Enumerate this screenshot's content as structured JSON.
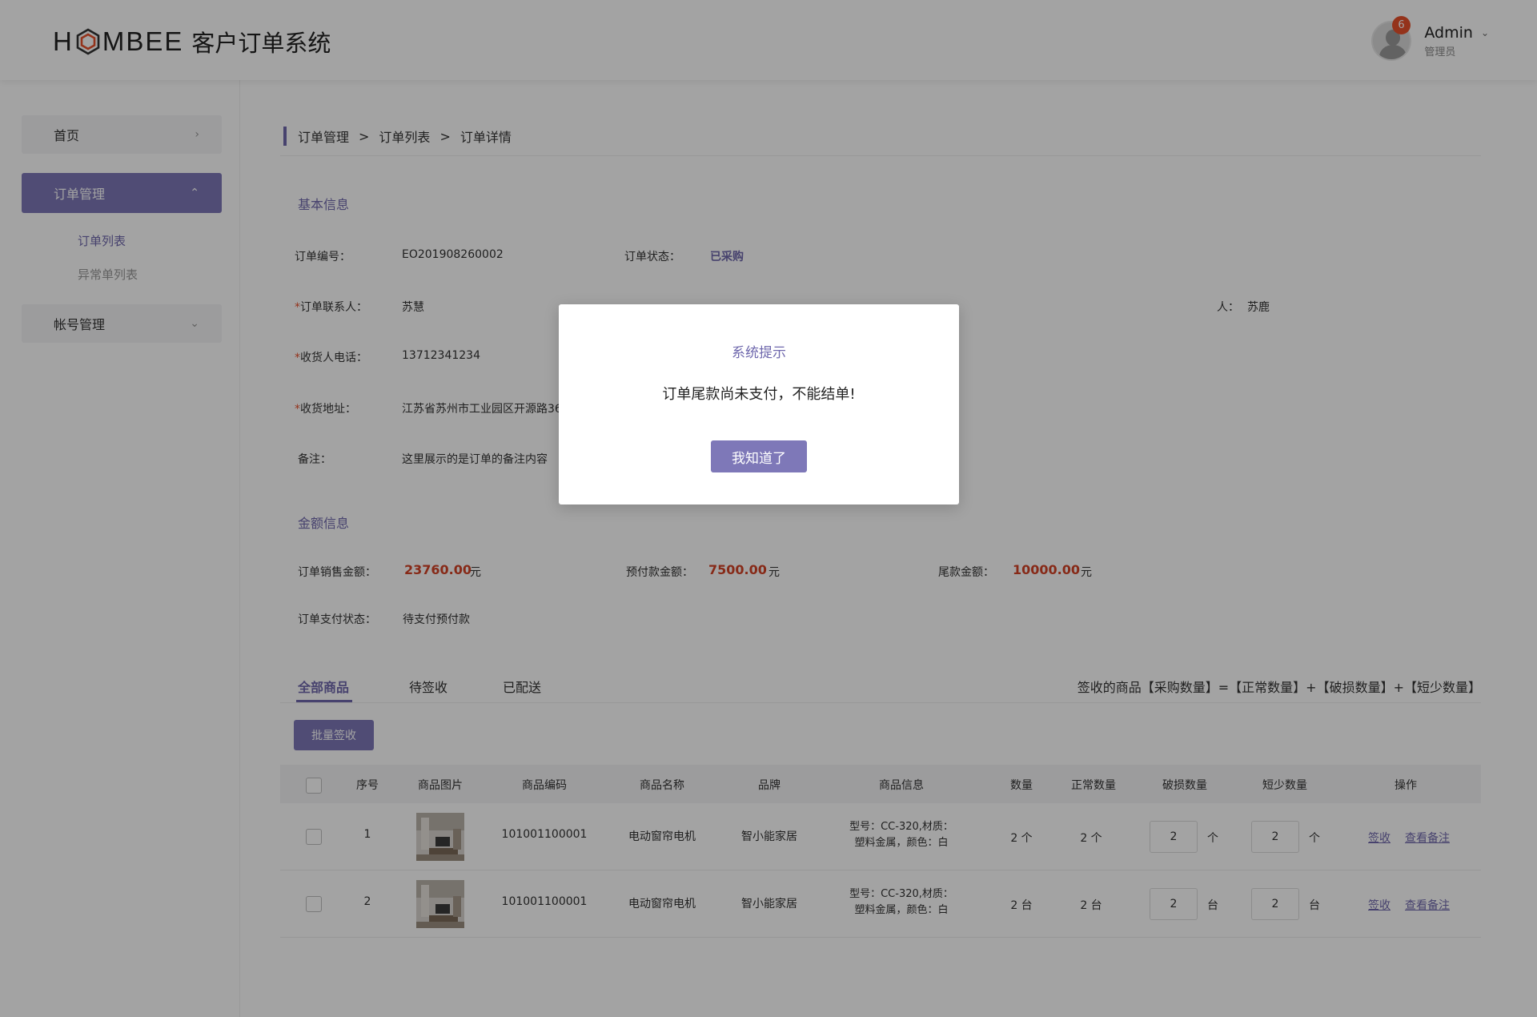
{
  "header": {
    "logo_prefix": "H",
    "logo_suffix": "MBEE",
    "system_name": "客户订单系统",
    "user_name": "Admin",
    "user_role": "管理员",
    "notification_count": "6",
    "chevron": "⌄"
  },
  "sidebar": {
    "home": "首页",
    "order_mgmt": "订单管理",
    "order_list": "订单列表",
    "exception_list": "异常单列表",
    "account_mgmt": "帐号管理",
    "arrow_right": "›",
    "arrow_up": "⌃",
    "arrow_down": "⌄"
  },
  "breadcrumb": [
    "订单管理",
    "订单列表",
    "订单详情"
  ],
  "breadcrumb_sep": ">",
  "basic": {
    "title": "基本信息",
    "order_no_label": "订单编号：",
    "order_no": "EO201908260002",
    "status_label": "订单状态：",
    "status": "已采购",
    "contact_label": "订单联系人：",
    "contact": "苏慧",
    "receiver_label_partial": "人：",
    "receiver": "苏鹿",
    "phone_label": "收货人电话：",
    "phone": "13712341234",
    "address_label": "收货地址：",
    "address": "江苏省苏州市工业园区开源路36",
    "remark_label": "备注：",
    "remark": "这里展示的是订单的备注内容",
    "required_mark": "*"
  },
  "amount": {
    "title": "金额信息",
    "sale_label": "订单销售金额：",
    "sale": "23760.00",
    "prepay_label": "预付款金额：",
    "prepay": "7500.00",
    "final_label": "尾款金额：",
    "final": "10000.00",
    "currency": "元",
    "pay_status_label": "订单支付状态：",
    "pay_status": "待支付预付款"
  },
  "tabs": [
    "全部商品",
    "待签收",
    "已配送"
  ],
  "formula": "签收的商品【采购数量】=【正常数量】+【破损数量】+【短少数量】",
  "batch_button": "批量签收",
  "table": {
    "headers": [
      "序号",
      "商品图片",
      "商品编码",
      "商品名称",
      "品牌",
      "商品信息",
      "数量",
      "正常数量",
      "破损数量",
      "短少数量",
      "操作"
    ],
    "rows": [
      {
        "no": "1",
        "code": "101001100001",
        "name": "电动窗帘电机",
        "brand": "智小能家居",
        "info1": "型号：CC-320,材质：",
        "info2": "塑料金属，颜色：白",
        "qty": "2 个",
        "normal": "2 个",
        "damaged": "2",
        "damaged_unit": "个",
        "short": "2",
        "short_unit": "个",
        "sign": "签收",
        "remark": "查看备注"
      },
      {
        "no": "2",
        "code": "101001100001",
        "name": "电动窗帘电机",
        "brand": "智小能家居",
        "info1": "型号：CC-320,材质：",
        "info2": "塑料金属，颜色：白",
        "qty": "2 台",
        "normal": "2 台",
        "damaged": "2",
        "damaged_unit": "台",
        "short": "2",
        "short_unit": "台",
        "sign": "签收",
        "remark": "查看备注"
      }
    ]
  },
  "modal": {
    "title": "系统提示",
    "message": "订单尾款尚未支付，不能结单!",
    "button": "我知道了"
  },
  "colors": {
    "accent": "#7e78b8",
    "accent_text": "#6f68ad",
    "amount_red": "#d34327",
    "badge": "#e8502b"
  }
}
